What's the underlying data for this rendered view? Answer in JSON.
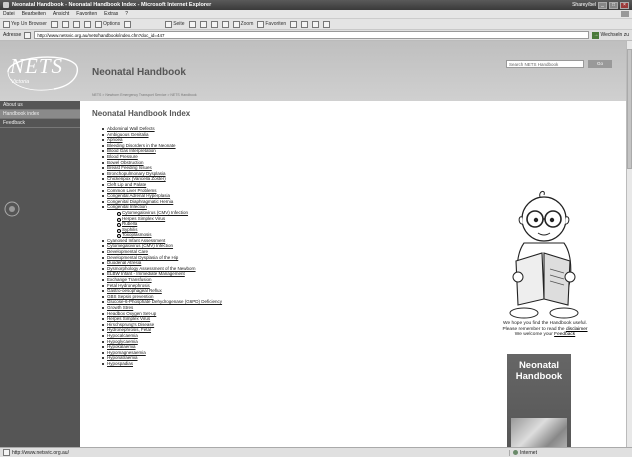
{
  "window": {
    "title": "Neonatal Handbook - Neonatal Handbook Index - Microsoft Internet Explorer",
    "right_label": "Sharey/bel"
  },
  "menu": [
    "Datei",
    "Bearbeiten",
    "Ansicht",
    "Favoriten",
    "Extras",
    "?"
  ],
  "toolbar": {
    "items": [
      "Yep Un Browser",
      "Options",
      "Seite",
      "Zoom",
      "Favoriten"
    ]
  },
  "address": {
    "label": "Adresse",
    "url": "http://www.netsvic.org.au/nets/handbook/index.cfm?doc_id=447",
    "go": "Wechseln zu"
  },
  "site": {
    "logo_main": "NETS",
    "logo_sub": "Victoria",
    "title": "Neonatal Handbook",
    "breadcrumb": "NETS > Newborn Emergency Transport Service > NETS Handbook",
    "search_placeholder": "Search NETS Handbook",
    "search_button": "Go"
  },
  "nav": [
    {
      "label": "About us",
      "active": false
    },
    {
      "label": "Handbook index",
      "active": true
    },
    {
      "label": "Feedback",
      "active": false
    }
  ],
  "content": {
    "heading": "Neonatal Handbook Index",
    "items": [
      {
        "label": "Abdominal Wall Defects"
      },
      {
        "label": "Ambiguous Genitalia"
      },
      {
        "label": "Apnoea"
      },
      {
        "label": "Bleeding Disorders in the Neonate"
      },
      {
        "label": "Blood Gas Interpretation"
      },
      {
        "label": "Blood Pressure"
      },
      {
        "label": "Bowel Obstruction"
      },
      {
        "label": "Breast Feeding Issues"
      },
      {
        "label": "Bronchopulmonary Dysplasia"
      },
      {
        "label": "Chickenpox (Varicella Zoster)"
      },
      {
        "label": "Cleft Lip and Palate"
      },
      {
        "label": "Common Liver Problems"
      },
      {
        "label": "Congenital Adrenal Hyperplasia"
      },
      {
        "label": "Congenital Diaphragmatic Hernia"
      },
      {
        "label": "Congenital Infection",
        "sub": [
          "Cytomegalovirus (CMV) Infection",
          "Herpes Simplex Virus",
          "Rubella",
          "Syphilis",
          "Toxoplasmosis"
        ]
      },
      {
        "label": "Cyanosed Infant Assessment"
      },
      {
        "label": "Cytomegalovirus (CMV) Infection"
      },
      {
        "label": "Developmental Care"
      },
      {
        "label": "Developmental Dysplasia of the Hip"
      },
      {
        "label": "Duodenal Atresia"
      },
      {
        "label": "Dysmorphology Assessment of the Newborn"
      },
      {
        "label": "ELBW Infant - Immediate Management"
      },
      {
        "label": "Exchange Transfusion"
      },
      {
        "label": "Fetal Hydronephrosis"
      },
      {
        "label": "Gastro-oesophageal Reflux"
      },
      {
        "label": "GBS Sepsis prevention"
      },
      {
        "label": "Glucose-6-Phosphate Dehydrogenase (G6PD) Deficiency"
      },
      {
        "label": "Growth Stres"
      },
      {
        "label": "Headbox Oxygen Set-up"
      },
      {
        "label": "Herpes Simplex Virus"
      },
      {
        "label": "Hirschsprung's Disease"
      },
      {
        "label": "Hydronephrosis, Fetal"
      },
      {
        "label": "Hypocalcaemia"
      },
      {
        "label": "Hypoglycaemia"
      },
      {
        "label": "Hypokalaemia"
      },
      {
        "label": "Hypomagnesaemia"
      },
      {
        "label": "Hyponatraemia"
      },
      {
        "label": "Hypospadias"
      }
    ]
  },
  "right": {
    "welcome_line1": "We hope you find the Handbook useful.",
    "welcome_line2_pre": "Please remember to read the ",
    "welcome_link1": "disclaimer",
    "welcome_line3_pre": "We welcome your ",
    "welcome_link2": "Feedback",
    "book_title": "Neonatal Handbook"
  },
  "status": {
    "url": "http://www.netsvic.org.au/",
    "zone": "Internet"
  }
}
